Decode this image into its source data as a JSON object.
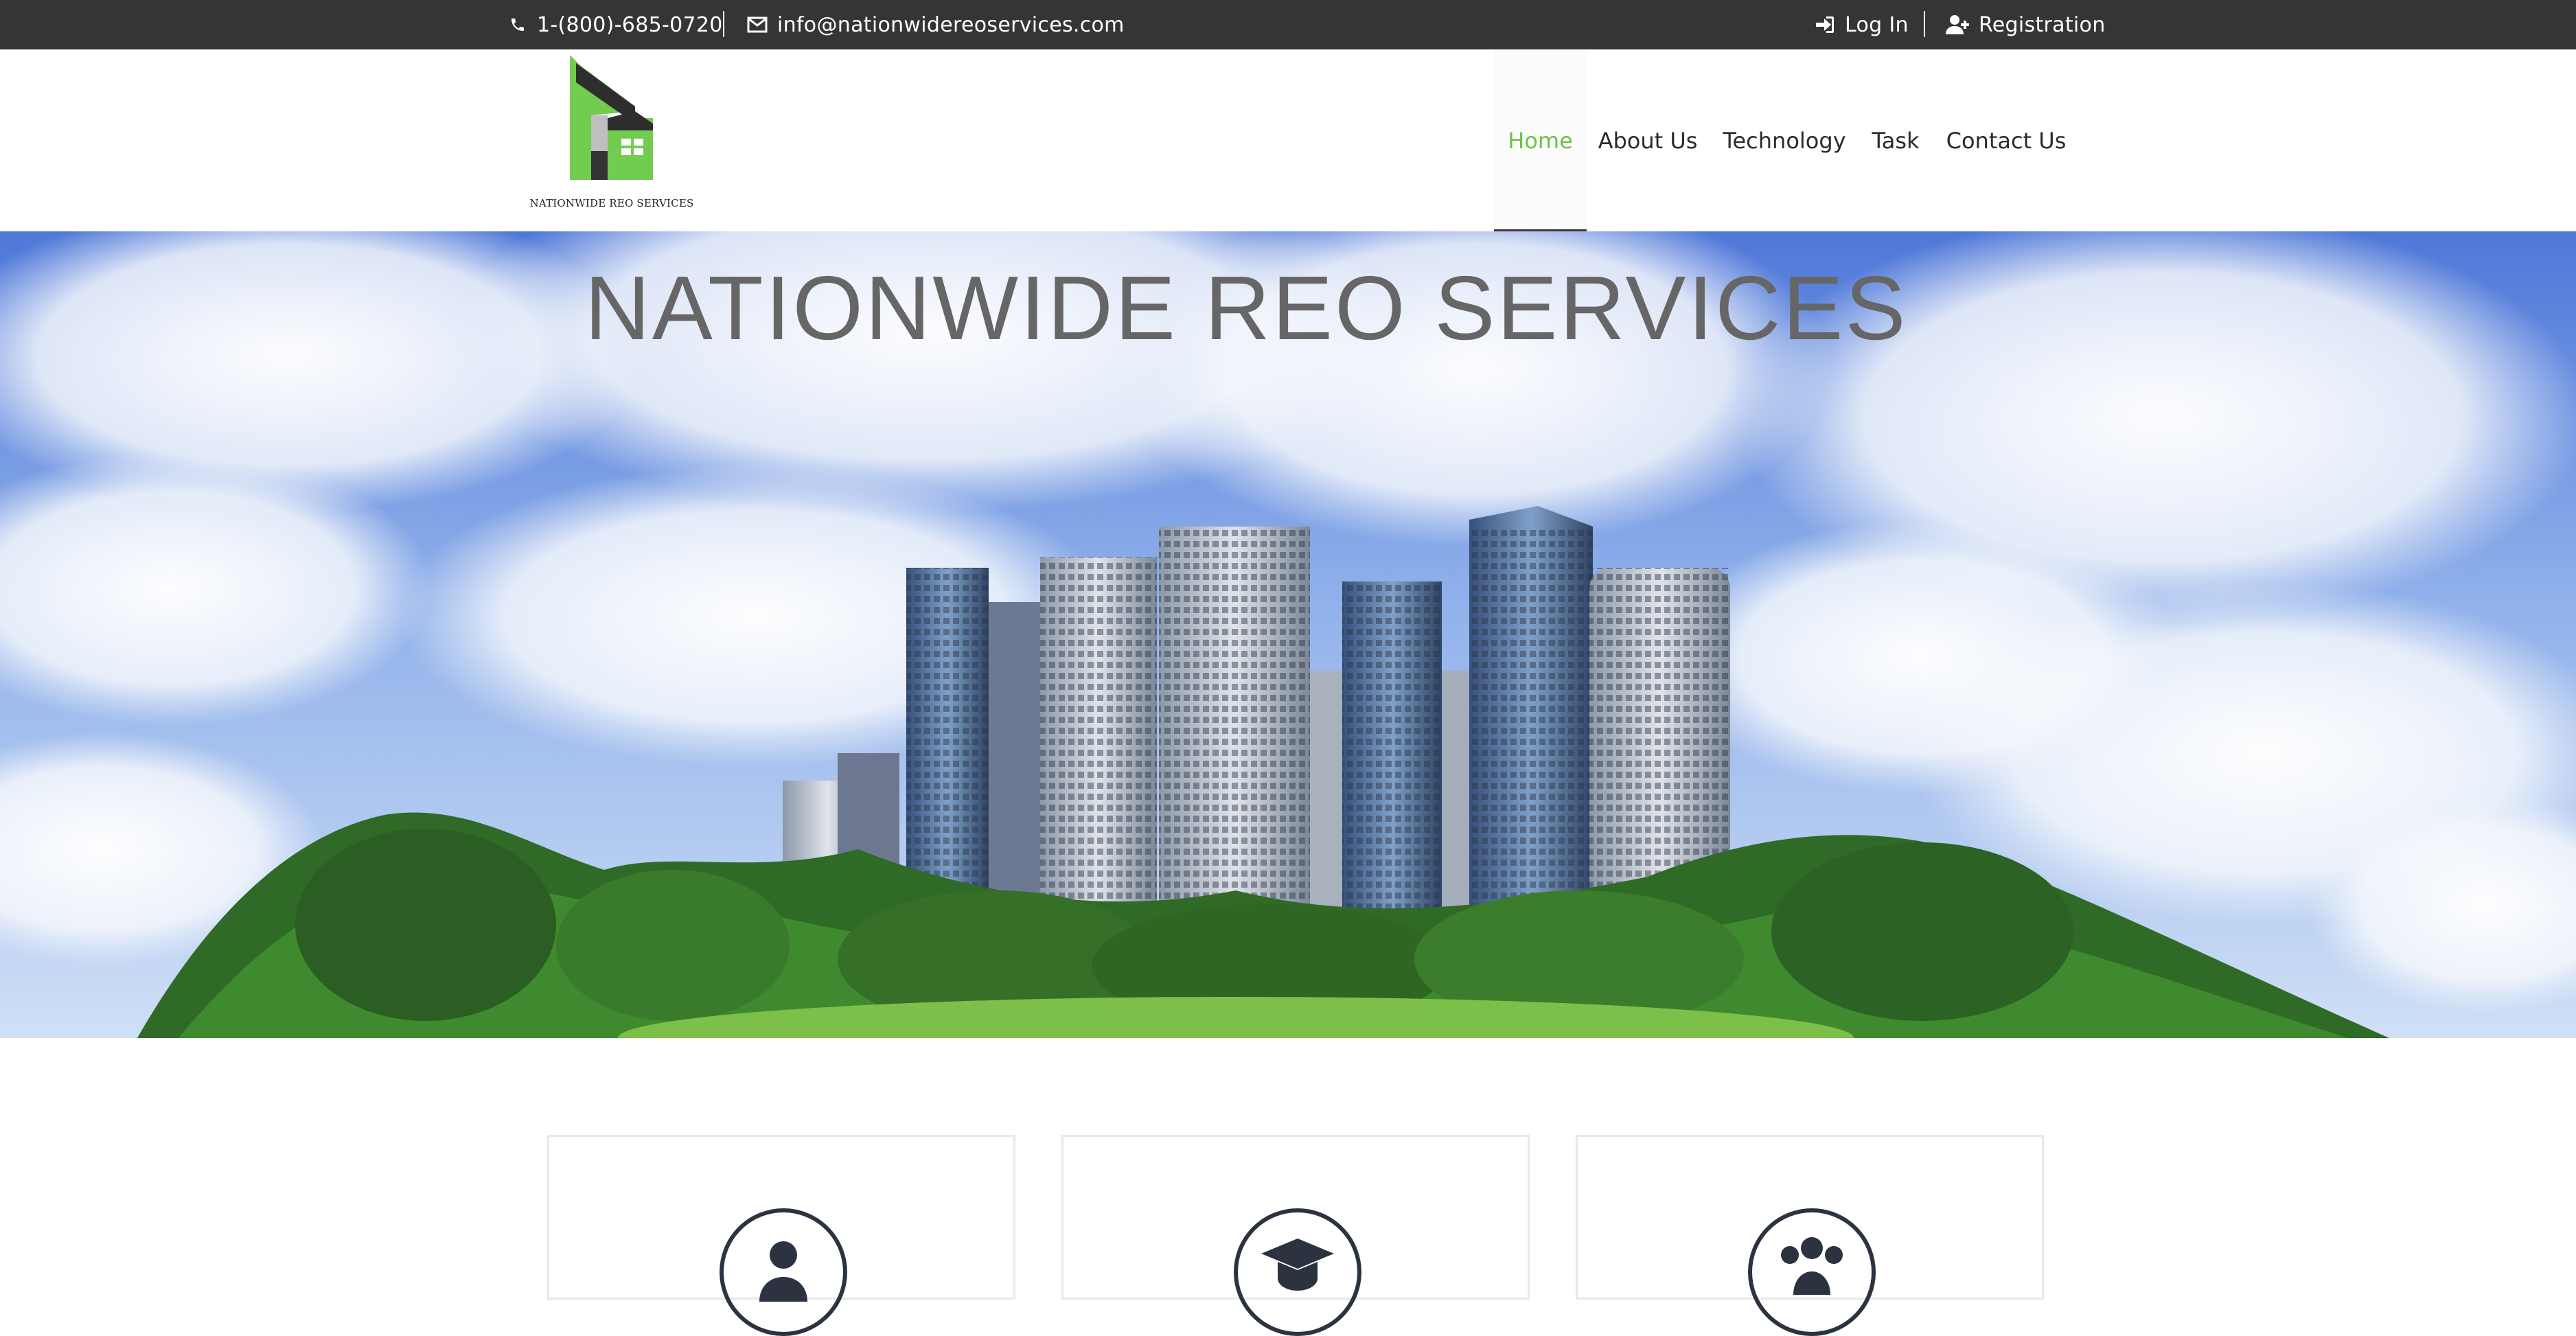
{
  "topbar": {
    "phone": "1-(800)-685-0720",
    "email": "info@nationwidereoservices.com",
    "login": "Log In",
    "registration": "Registration",
    "icons": [
      "phone-icon",
      "envelope-icon",
      "sign-in-icon",
      "user-plus-icon"
    ]
  },
  "header": {
    "logo_text": "NATIONWIDE REO SERVICES",
    "nav": [
      {
        "label": "Home",
        "active": true
      },
      {
        "label": "About Us",
        "active": false
      },
      {
        "label": "Technology",
        "active": false
      },
      {
        "label": "Task",
        "active": false
      },
      {
        "label": "Contact Us",
        "active": false
      }
    ]
  },
  "hero": {
    "title": "NATIONWIDE REO SERVICES"
  },
  "features": [
    {
      "icon": "user-icon"
    },
    {
      "icon": "graduation-cap-icon"
    },
    {
      "icon": "users-icon"
    }
  ],
  "colors": {
    "topbar_bg": "#353535",
    "accent": "#6cc24a",
    "text_dark": "#2b2b2b",
    "hero_title": "#666666",
    "icon_dark": "#2c3340"
  }
}
